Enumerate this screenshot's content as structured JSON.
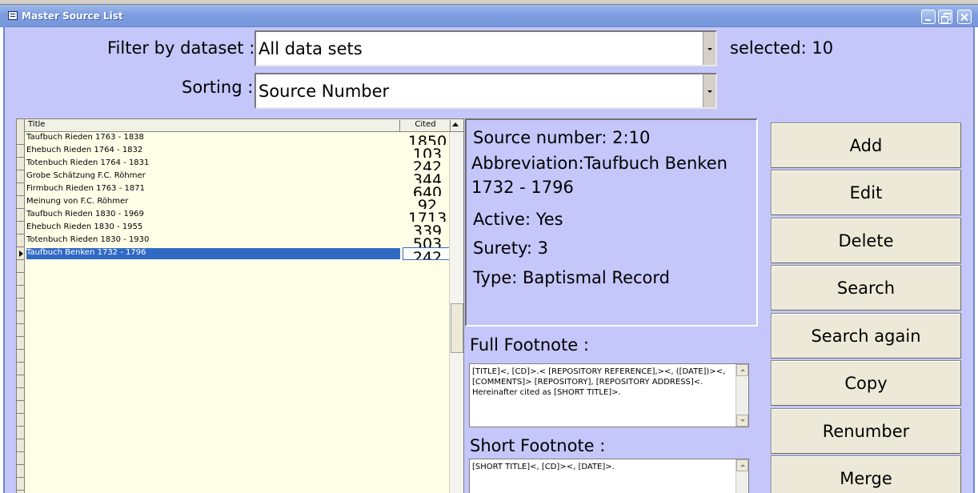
{
  "window": {
    "title": "Master Source List"
  },
  "filter": {
    "label": "Filter by dataset :",
    "value": "All data sets",
    "selected_text": "selected: 10"
  },
  "sorting": {
    "label": "Sorting :",
    "value": "Source Number"
  },
  "grid": {
    "columns": {
      "title": "Title",
      "cited": "Cited"
    },
    "rows": [
      {
        "title": "Taufbuch Rieden 1763 - 1838",
        "cited": "1850"
      },
      {
        "title": "Ehebuch Rieden 1764 - 1832",
        "cited": "103"
      },
      {
        "title": "Totenbuch Rieden 1764 - 1831",
        "cited": "242"
      },
      {
        "title": "Grobe Schätzung F.C. Röhmer",
        "cited": "344"
      },
      {
        "title": "Firmbuch Rieden 1763 - 1871",
        "cited": "640"
      },
      {
        "title": "Meinung von F.C. Röhmer",
        "cited": "92"
      },
      {
        "title": "Taufbuch Rieden 1830 - 1969",
        "cited": "1713"
      },
      {
        "title": "Ehebuch Rieden 1830 - 1955",
        "cited": "339"
      },
      {
        "title": "Totenbuch Rieden 1830 - 1930",
        "cited": "503"
      },
      {
        "title": "Taufbuch Benken 1732 - 1796",
        "cited": "242"
      }
    ],
    "selected_index": 9
  },
  "details": {
    "source_number": "Source number: 2:10",
    "abbreviation_line1": "Abbreviation:Taufbuch Benken",
    "abbreviation_line2": "1732 - 1796",
    "active": "Active: Yes",
    "surety": "Surety: 3",
    "type": "Type: Baptismal Record"
  },
  "footnotes": {
    "full_label": "Full Footnote :",
    "full_line1": "[TITLE]<, [CD]>.< [REPOSITORY REFERENCE],><, ([DATE])><,",
    "full_line2": "[COMMENTS]> [REPOSITORY], [REPOSITORY ADDRESS]<.",
    "full_line3": "Hereinafter cited as [SHORT TITLE]>.",
    "short_label": "Short Footnote :",
    "short_text": "[SHORT TITLE]<, [CD]><, [DATE]>."
  },
  "buttons": {
    "add": "Add",
    "edit": "Edit",
    "delete": "Delete",
    "search": "Search",
    "search_again": "Search again",
    "copy": "Copy",
    "renumber": "Renumber",
    "merge": "Merge"
  },
  "colors": {
    "form_background": "#c5c6f9",
    "titlebar": "#7f9ee0",
    "grid_background": "#ffffe8",
    "selection": "#316ac5"
  }
}
